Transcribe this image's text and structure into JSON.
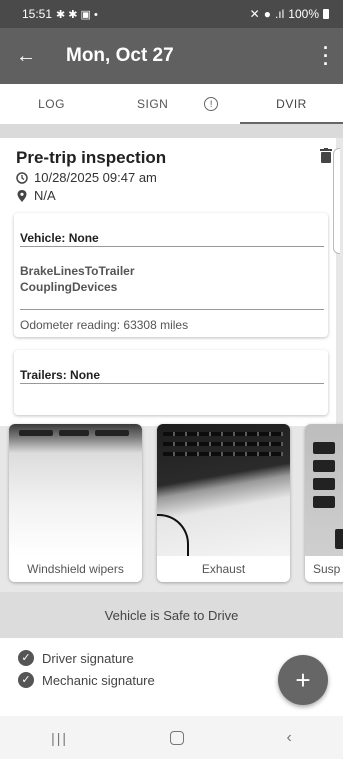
{
  "status_bar": {
    "time": "15:51",
    "battery": "100%"
  },
  "app_bar": {
    "title": "Mon, Oct 27"
  },
  "tabs": [
    {
      "label": "LOG"
    },
    {
      "label": "SIGN"
    },
    {
      "label": "DVIR"
    }
  ],
  "inspection": {
    "title": "Pre-trip inspection",
    "datetime": "10/28/2025 09:47 am",
    "location": "N/A",
    "vehicle": {
      "header": "Vehicle: None",
      "defects": [
        "BrakeLinesToTrailer",
        "CouplingDevices"
      ],
      "odometer": "Odometer reading: 63308 miles"
    },
    "trailers": {
      "header": "Trailers: None"
    }
  },
  "photos": [
    {
      "caption": "Windshield wipers"
    },
    {
      "caption": "Exhaust"
    },
    {
      "caption": "Susp"
    }
  ],
  "status_text": "Vehicle is Safe to Drive",
  "signatures": [
    {
      "label": "Driver signature"
    },
    {
      "label": "Mechanic signature"
    }
  ],
  "fab": {
    "label": "+"
  },
  "colors": {
    "app_bar": "#606060",
    "status_bar": "#4a4a4a",
    "safe_bar": "#dcdcdc"
  }
}
